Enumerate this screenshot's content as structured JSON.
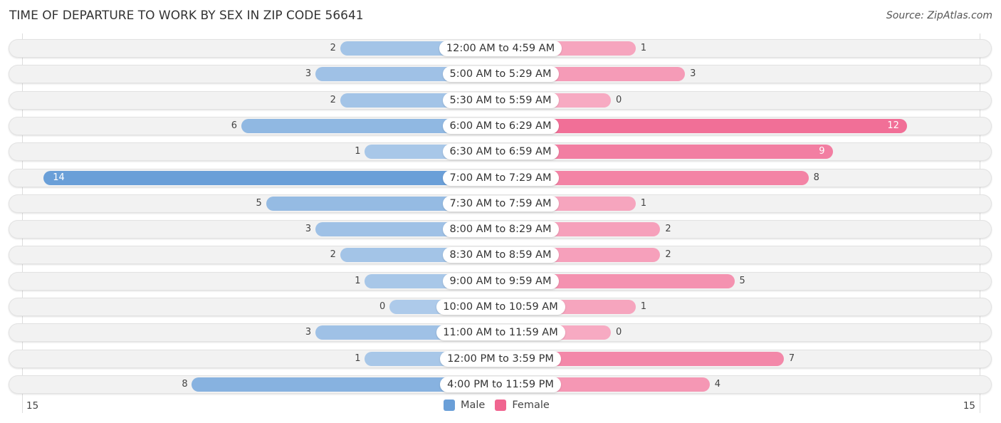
{
  "chart_data": {
    "type": "bar",
    "orientation": "horizontal-butterfly",
    "title": "TIME OF DEPARTURE TO WORK BY SEX IN ZIP CODE 56641",
    "source": "Source: ZipAtlas.com",
    "categories": [
      "12:00 AM to 4:59 AM",
      "5:00 AM to 5:29 AM",
      "5:30 AM to 5:59 AM",
      "6:00 AM to 6:29 AM",
      "6:30 AM to 6:59 AM",
      "7:00 AM to 7:29 AM",
      "7:30 AM to 7:59 AM",
      "8:00 AM to 8:29 AM",
      "8:30 AM to 8:59 AM",
      "9:00 AM to 9:59 AM",
      "10:00 AM to 10:59 AM",
      "11:00 AM to 11:59 AM",
      "12:00 PM to 3:59 PM",
      "4:00 PM to 11:59 PM"
    ],
    "series": [
      {
        "name": "Male",
        "color": "#6a9fd8",
        "values": [
          2,
          3,
          2,
          6,
          1,
          14,
          5,
          3,
          2,
          1,
          0,
          3,
          1,
          8
        ]
      },
      {
        "name": "Female",
        "color": "#f06590",
        "values": [
          1,
          3,
          0,
          12,
          9,
          8,
          1,
          2,
          2,
          5,
          1,
          0,
          7,
          4
        ]
      }
    ],
    "axis": {
      "left_label": "15",
      "right_label": "15",
      "max": 15
    },
    "legend": {
      "placement": "bottom-center",
      "items": [
        "Male",
        "Female"
      ]
    }
  }
}
